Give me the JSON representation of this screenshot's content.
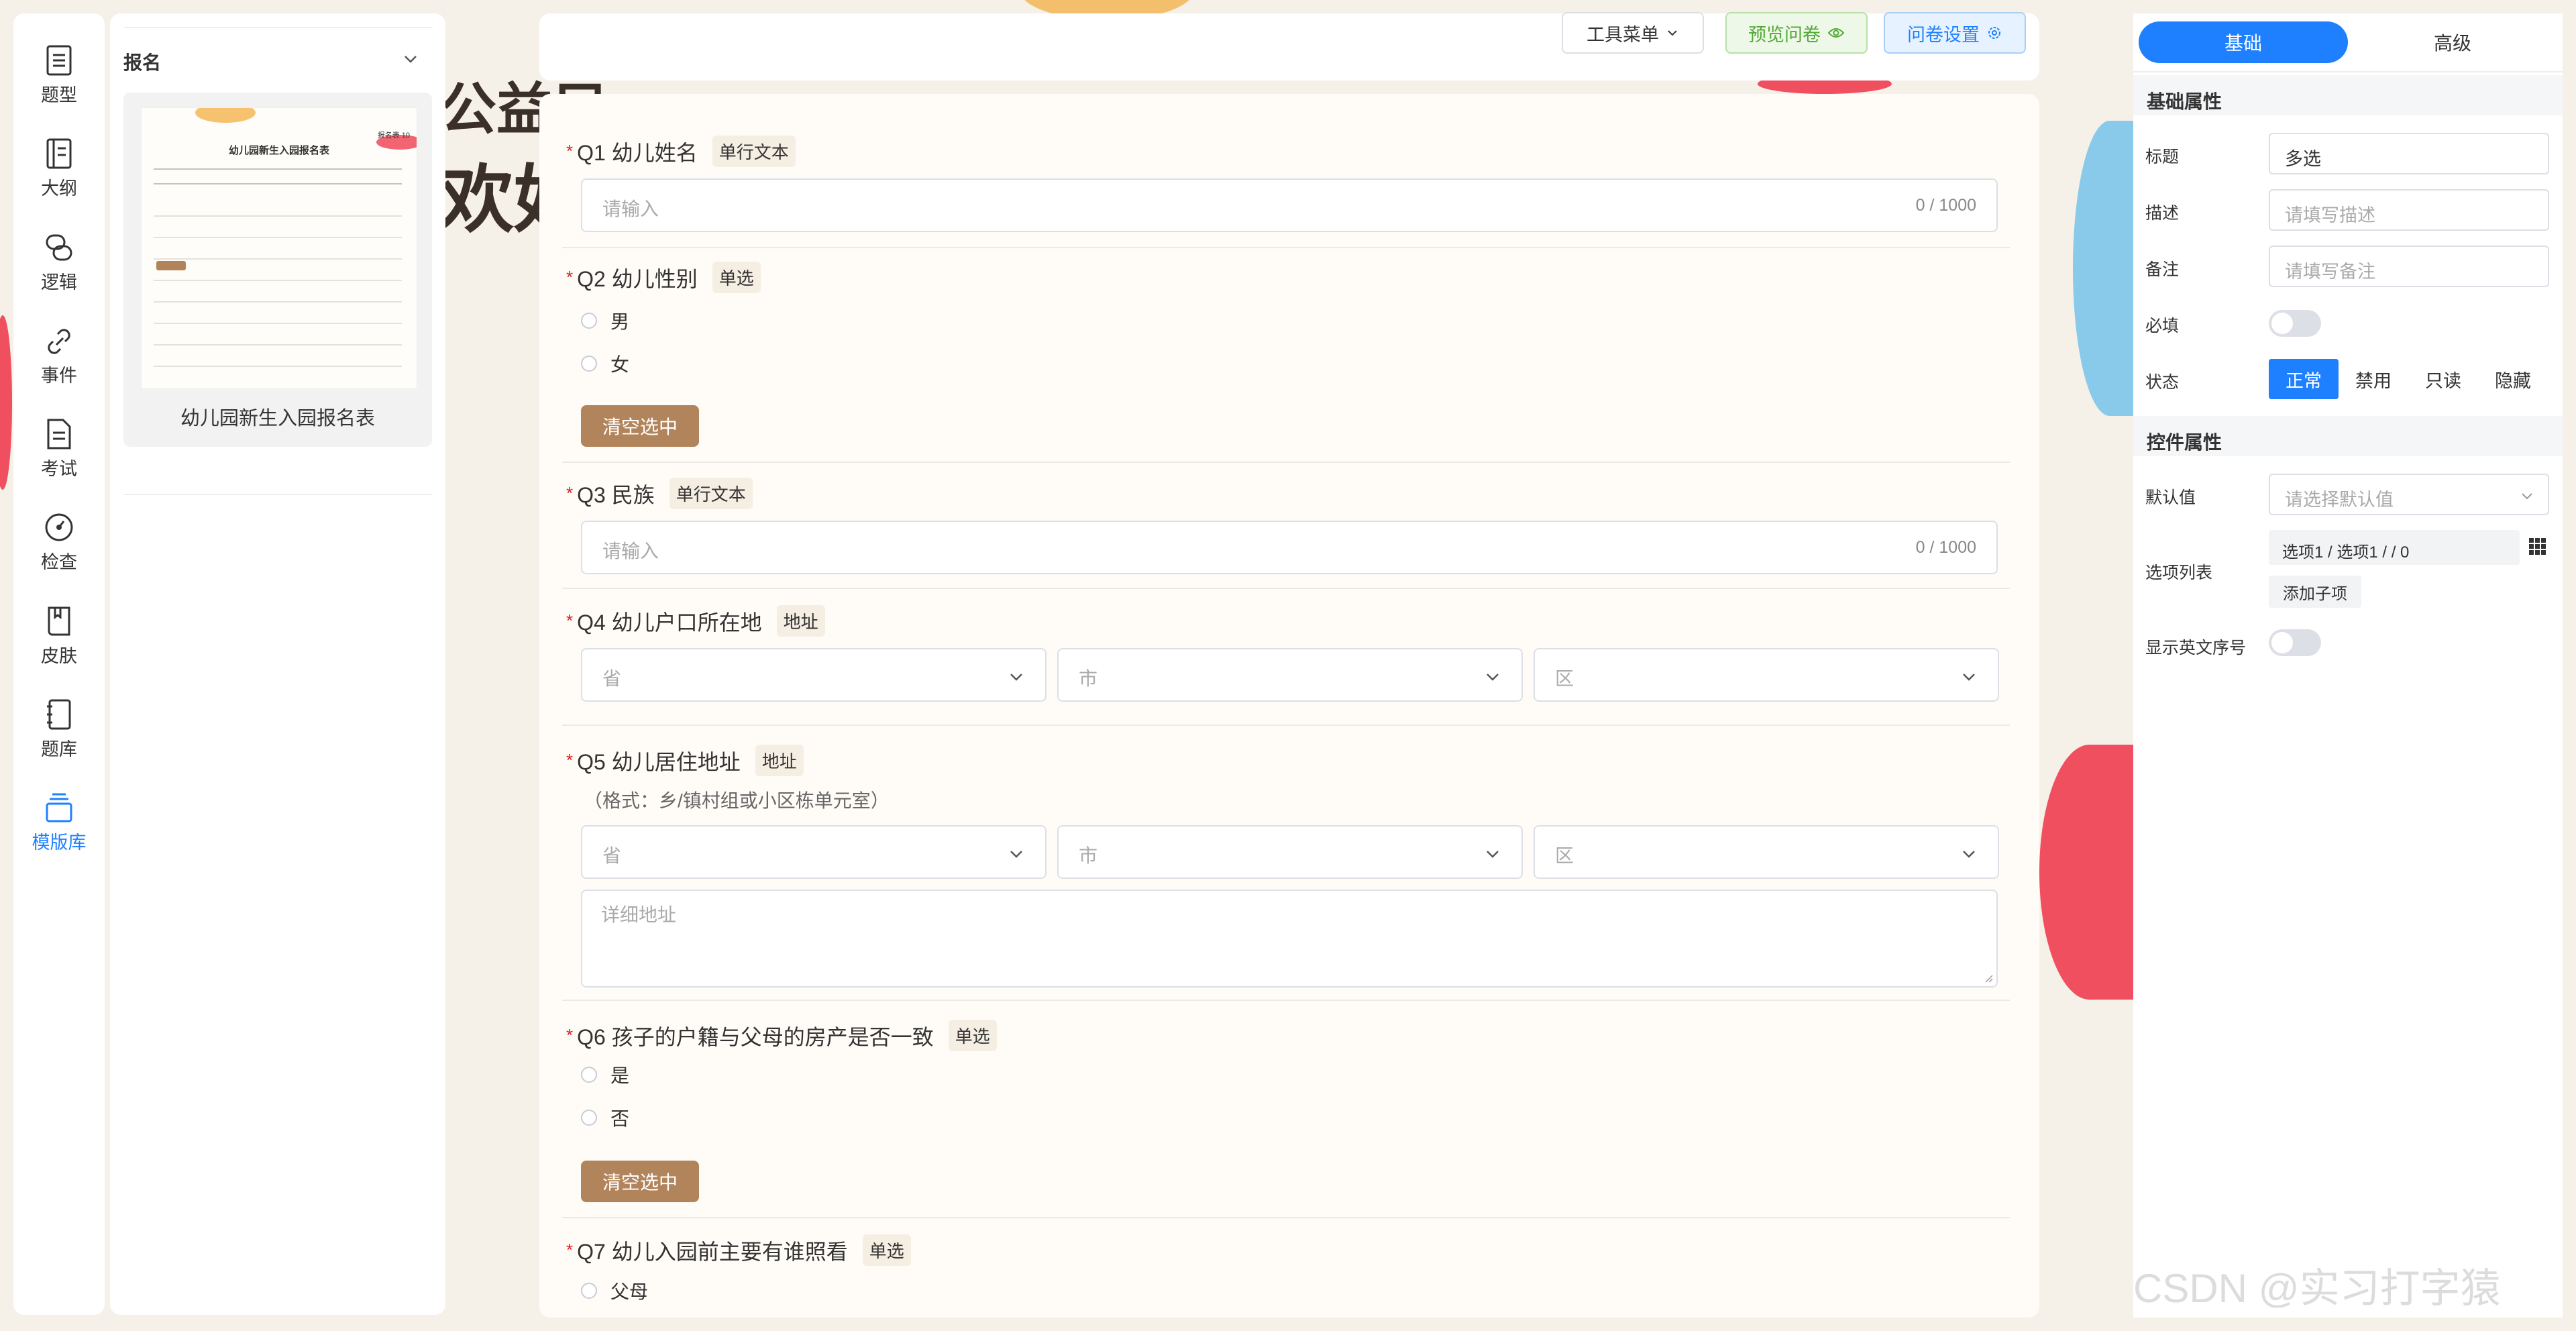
{
  "rail": {
    "items": [
      {
        "label": "题型",
        "icon": "question-type-icon"
      },
      {
        "label": "大纲",
        "icon": "outline-icon"
      },
      {
        "label": "逻辑",
        "icon": "logic-icon"
      },
      {
        "label": "事件",
        "icon": "link-icon"
      },
      {
        "label": "考试",
        "icon": "exam-icon"
      },
      {
        "label": "检查",
        "icon": "check-icon"
      },
      {
        "label": "皮肤",
        "icon": "skin-icon"
      },
      {
        "label": "题库",
        "icon": "question-bank-icon"
      },
      {
        "label": "模版库",
        "icon": "template-icon"
      }
    ],
    "active_index": 8,
    "active_color": "#1e80ff"
  },
  "outline": {
    "section_title": "报名",
    "template_name": "幼儿园新生入园报名表",
    "thumb": {
      "title": "幼儿园新生入园报名表",
      "page_badge": "报名表 10"
    }
  },
  "background": {
    "title_line1": "公益巳",
    "title_line2": "欢好"
  },
  "toolbar": {
    "tools_menu": "工具菜单",
    "preview": "预览问卷",
    "settings": "问卷设置"
  },
  "questions": [
    {
      "title": "Q1 幼儿姓名",
      "type": "单行文本",
      "placeholder": "请输入",
      "counter": "0 / 1000"
    },
    {
      "title": "Q2 幼儿性别",
      "type": "单选",
      "options": [
        "男",
        "女"
      ],
      "clear_label": "清空选中"
    },
    {
      "title": "Q3 民族",
      "type": "单行文本",
      "placeholder": "请输入",
      "counter": "0 / 1000"
    },
    {
      "title": "Q4 幼儿户口所在地",
      "type": "地址",
      "province": "省",
      "city": "市",
      "district": "区"
    },
    {
      "title": "Q5 幼儿居住地址",
      "type": "地址",
      "hint": "（格式：乡/镇村组或小区栋单元室）",
      "province": "省",
      "city": "市",
      "district": "区",
      "detail_placeholder": "详细地址"
    },
    {
      "title": "Q6 孩子的户籍与父母的房产是否一致",
      "type": "单选",
      "options": [
        "是",
        "否"
      ],
      "clear_label": "清空选中"
    },
    {
      "title": "Q7 幼儿入园前主要有谁照看",
      "type": "单选",
      "options": [
        "父母"
      ]
    }
  ],
  "props": {
    "tabs": {
      "basic": "基础",
      "advanced": "高级"
    },
    "basic_section": "基础属性",
    "title_label": "标题",
    "title_value": "多选",
    "desc_label": "描述",
    "desc_placeholder": "请填写描述",
    "note_label": "备注",
    "note_placeholder": "请填写备注",
    "required_label": "必填",
    "required": false,
    "status_label": "状态",
    "status_options": [
      "正常",
      "禁用",
      "只读",
      "隐藏"
    ],
    "status_selected": "正常",
    "control_section": "控件属性",
    "default_label": "默认值",
    "default_placeholder": "请选择默认值",
    "options_label": "选项列表",
    "options_value": "选项1 / 选项1 / / 0",
    "add_child": "添加子项",
    "english_label": "显示英文序号",
    "english": false
  },
  "watermark": "CSDN @实习打字猿",
  "colors": {
    "accent": "#1e80ff",
    "clear_button": "#b2845b",
    "preview_bg": "#eef8e9",
    "preview_text": "#52a834",
    "settings_bg": "#e6f2ff",
    "settings_text": "#1e80ff",
    "required": "#e02020"
  }
}
